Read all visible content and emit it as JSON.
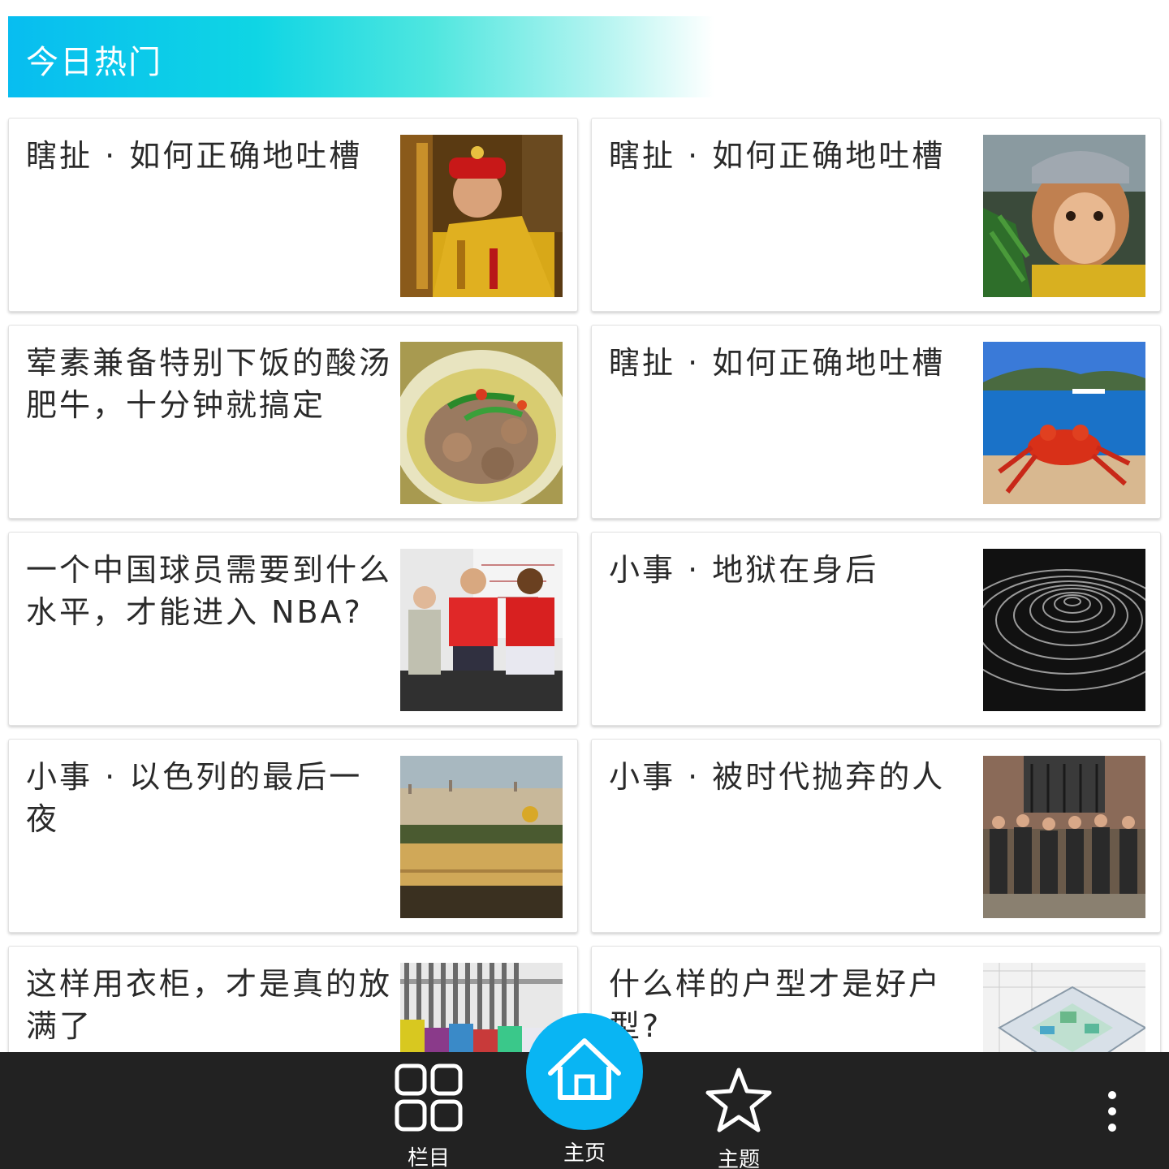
{
  "header": {
    "title": "今日热门"
  },
  "cards": [
    {
      "title": "瞎扯 · 如何正确地吐槽",
      "thumb": "emperor-portrait"
    },
    {
      "title": "瞎扯 · 如何正确地吐槽",
      "thumb": "monkey-king-portrait"
    },
    {
      "title": "荤素兼备特别下饭的酸汤肥牛，十分钟就搞定",
      "thumb": "beef-soup-bowl"
    },
    {
      "title": "瞎扯 · 如何正确地吐槽",
      "thumb": "crab-by-sea"
    },
    {
      "title": "一个中国球员需要到什么水平，才能进入 NBA?",
      "thumb": "basketball-players"
    },
    {
      "title": "小事 · 地狱在身后",
      "thumb": "fingerprint-closeup"
    },
    {
      "title": "小事 · 以色列的最后一夜",
      "thumb": "jerusalem-city"
    },
    {
      "title": "小事 · 被时代抛弃的人",
      "thumb": "group-of-men"
    },
    {
      "title": "这样用衣柜，才是真的放满了",
      "thumb": "hanging-clothes"
    },
    {
      "title": "什么样的户型才是好户型?",
      "thumb": "floor-plan-3d"
    }
  ],
  "nav": {
    "columns_label": "栏目",
    "home_label": "主页",
    "topics_label": "主题",
    "columns_icon": "grid-icon",
    "home_icon": "home-icon",
    "topics_icon": "star-icon",
    "more_icon": "more-vertical-icon"
  },
  "colors": {
    "accent": "#09b5f3",
    "nav_background": "#222222",
    "header_gradient_start": "#08bdf0"
  }
}
